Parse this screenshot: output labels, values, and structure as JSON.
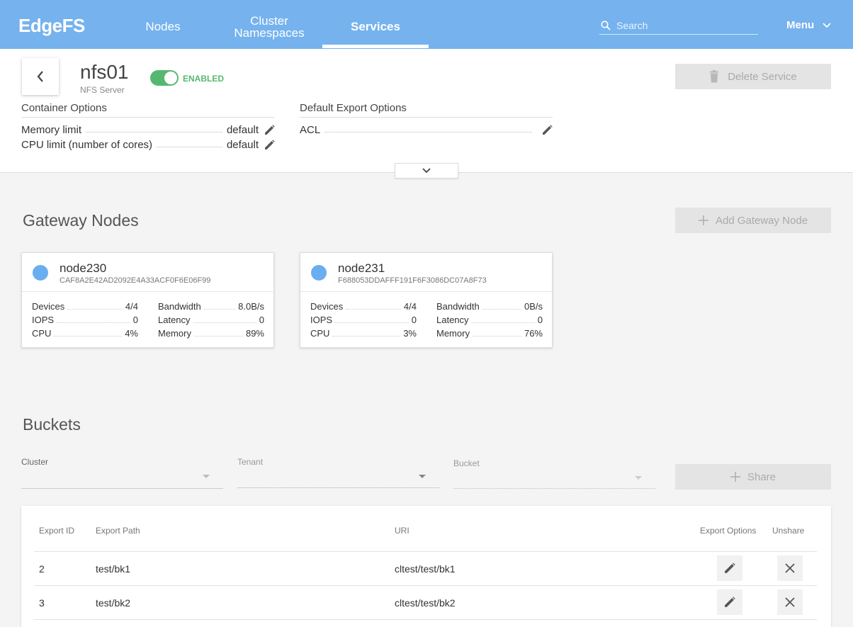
{
  "nav": {
    "brand": "EdgeFS",
    "tabs": [
      {
        "label": "Nodes"
      },
      {
        "label": "Cluster Namespaces"
      },
      {
        "label": "Services"
      }
    ],
    "active_tab": "Services",
    "search_placeholder": "Search",
    "menu_label": "Menu"
  },
  "service": {
    "name": "nfs01",
    "type": "NFS Server",
    "status_label": "ENABLED",
    "enabled": true,
    "delete_label": "Delete Service"
  },
  "container_options": {
    "title": "Container Options",
    "rows": [
      {
        "label": "Memory limit",
        "value": "default"
      },
      {
        "label": "CPU limit (number of cores)",
        "value": "default"
      }
    ]
  },
  "export_options": {
    "title": "Default Export Options",
    "rows": [
      {
        "label": "ACL",
        "value": ""
      }
    ]
  },
  "gateway": {
    "title": "Gateway Nodes",
    "add_label": "Add Gateway Node",
    "nodes": [
      {
        "name": "node230",
        "id": "CAF8A2E42AD2092E4A33ACF0F6E06F99",
        "stats": {
          "devices": "4/4",
          "iops": "0",
          "cpu": "4%",
          "bandwidth": "8.0B/s",
          "latency": "0",
          "memory": "89%"
        }
      },
      {
        "name": "node231",
        "id": "F688053DDAFFF191F6F3086DC07A8F73",
        "stats": {
          "devices": "4/4",
          "iops": "0",
          "cpu": "3%",
          "bandwidth": "0B/s",
          "latency": "0",
          "memory": "76%"
        }
      }
    ],
    "stat_labels": {
      "devices": "Devices",
      "iops": "IOPS",
      "cpu": "CPU",
      "bandwidth": "Bandwidth",
      "latency": "Latency",
      "memory": "Memory"
    }
  },
  "buckets": {
    "title": "Buckets",
    "filters": {
      "cluster": "Cluster",
      "tenant": "Tenant",
      "bucket": "Bucket"
    },
    "share_label": "Share",
    "columns": {
      "export_id": "Export ID",
      "export_path": "Export Path",
      "uri": "URI",
      "export_options": "Export Options",
      "unshare": "Unshare"
    },
    "rows": [
      {
        "export_id": "2",
        "export_path": "test/bk1",
        "uri": "cltest/test/bk1"
      },
      {
        "export_id": "3",
        "export_path": "test/bk2",
        "uri": "cltest/test/bk2"
      }
    ]
  },
  "colors": {
    "topbar": "#75b2ee",
    "enabled": "#56b870",
    "node_dot": "#6aaef0"
  }
}
